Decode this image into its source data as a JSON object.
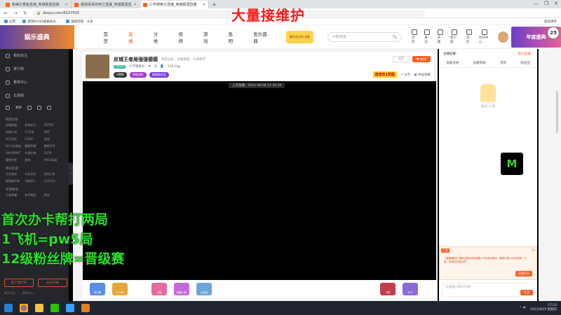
{
  "browser": {
    "tabs": [
      {
        "label": "和美比赛鱼直播_英雄联盟直播",
        "active": false
      },
      {
        "label": "蜡烛哥哥你用兰直播_英雄联盟直",
        "active": false
      },
      {
        "label": "小学德莱文直播_英雄联盟直播",
        "active": true
      }
    ],
    "new_tab": "+",
    "window_controls": [
      "—",
      "❐",
      "✕"
    ],
    "url": "douyu.com/6107915",
    "bookmarks": [
      "应用",
      "游戏NGQQ邮箱会员...",
      "搜索结果 - 头条"
    ],
    "reading_list": "阅读清单"
  },
  "overlay": {
    "title": "大量接维护",
    "lines": [
      "首次办卡帮打两局",
      "1飞机=pw5局",
      "12级粉丝牌=晋级赛"
    ],
    "circle_badge": "25"
  },
  "site_header": {
    "logo": "娱乐盛典",
    "nav": [
      {
        "label": "首页",
        "active": false
      },
      {
        "label": "直播",
        "active": true
      },
      {
        "label": "分类",
        "active": false
      },
      {
        "label": "视频",
        "active": false
      },
      {
        "label": "游戏",
        "active": false
      },
      {
        "label": "鱼吧",
        "active": false
      },
      {
        "label": "鱼乐盛典",
        "active": false
      }
    ],
    "promo": "撒年会过年 领取",
    "search_placeholder": "中路英雄",
    "icons": [
      {
        "name": "history",
        "label": "历史"
      },
      {
        "name": "follow",
        "label": "关注"
      },
      {
        "name": "open",
        "label": "开播"
      },
      {
        "name": "client",
        "label": "客户端"
      },
      {
        "name": "message",
        "label": "消息"
      },
      {
        "name": "creator",
        "label": "创作中心"
      }
    ],
    "right_banner": "年度盛典"
  },
  "sidebar": {
    "items": [
      {
        "label": "我的关注"
      },
      {
        "label": "排行榜"
      },
      {
        "label": "赛事中心"
      },
      {
        "label": "云游戏"
      }
    ],
    "sport_label": "赛事",
    "section1": "网游竞技",
    "grid1": [
      "英雄联盟",
      "绝地求生",
      "DOTA2",
      "穿越火线",
      "CF手游",
      "DNF",
      "炉石传说",
      "CSGO",
      "逆战",
      "QQ飞车端游",
      "魔兽争霸",
      "魔兽世界",
      "VALORANT",
      "守望先锋",
      "DOTA",
      "魔兽世界",
      "原神",
      "APEX英雄"
    ],
    "section2": "单机热游",
    "grid2": [
      "主机游戏",
      "永劫无间",
      "恐怖之夜",
      "暗黑破坏神",
      "怪物猎人",
      "方舟生存"
    ],
    "section3": "手游休闲",
    "grid3": [
      "王者荣耀",
      "和平精英",
      "原神"
    ],
    "buttons": [
      "客户端打开",
      "关注开播"
    ],
    "footer": [
      "新手任务",
      "帮助中心"
    ],
    "collapse": "‹"
  },
  "room": {
    "title": "皮城王者局强强德德",
    "category": "网游竞技 › 英雄联盟 › 大神教学",
    "level": "LV18",
    "streamer": "小学德莱文",
    "reports": "8",
    "fans": "134.2kg",
    "tags": [
      "V德德",
      "颈椎病犯",
      "超能粉丝团"
    ],
    "count": "127",
    "follow": "♥ 关注",
    "first_badge": "首成年1奖励",
    "share": "分享",
    "report": "举报弹幕",
    "last_live": "上次直播：2021-08-28 17:35:29"
  },
  "gifts": [
    "荧光棒",
    "小飞碟",
    "火箭",
    "超级火箭",
    "大宝剑",
    "飞机",
    "办卡"
  ],
  "right_panel": {
    "top_left": "主播招募 ›",
    "top_right": "鱼丸直播 ›",
    "tabs": [
      "贡献日榜",
      "贡献周榜",
      "贵宾",
      "粉丝团"
    ],
    "empty_text": "暂无人上榜",
    "monster_logo": "M",
    "ad": {
      "label": "广告",
      "text": "【直播通知】领取过程中将会抽取1千名幸运观众，赠送价值100元的第一飞奖！时间还在倒计时！",
      "button": "直播开始",
      "close": "✕"
    },
    "chat_placeholder": "这里输入聊天内容",
    "send": "发送"
  },
  "taskbar": {
    "apps": [
      "start",
      "browser",
      "explorer",
      "wechat",
      "chat",
      "game"
    ],
    "tray": "^ 中",
    "time": "17:23",
    "date": "2021/8/29 星期日"
  },
  "colors": {
    "accent": "#ff5d23",
    "overlay_red": "#ff1a1a",
    "overlay_green": "#28e028",
    "sidebar_bg": "#25262b"
  }
}
